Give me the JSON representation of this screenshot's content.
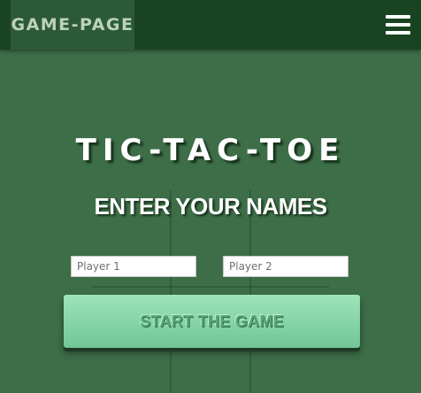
{
  "navbar": {
    "brand": "GAME-PAGE",
    "menu_icon": "hamburger-menu-icon"
  },
  "main": {
    "title": "TIC-TAC-TOE",
    "subtitle": "ENTER YOUR NAMES",
    "player1": {
      "placeholder": "Player 1",
      "value": ""
    },
    "player2": {
      "placeholder": "Player 2",
      "value": ""
    },
    "start_button": "START THE GAME"
  },
  "colors": {
    "background": "#3d6e47",
    "navbar": "#1a4321",
    "brand_bg": "#2d5a36",
    "button_top": "#9fe4b9",
    "button_bottom": "#70c695"
  }
}
